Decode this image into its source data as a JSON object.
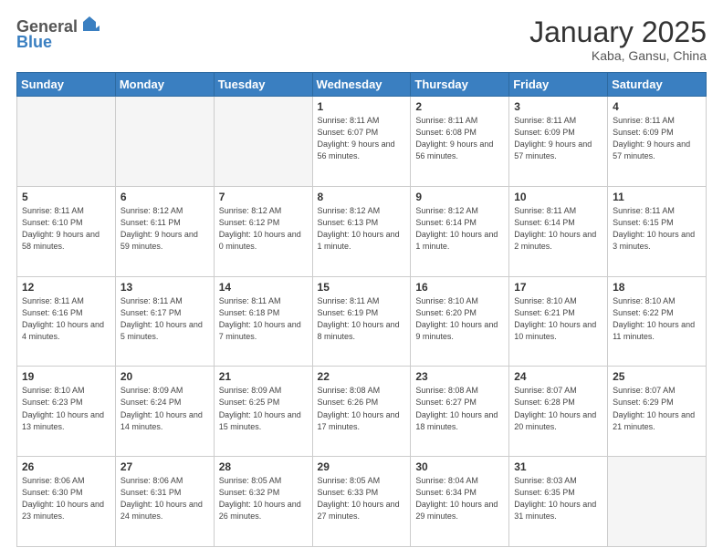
{
  "header": {
    "logo_general": "General",
    "logo_blue": "Blue",
    "month_title": "January 2025",
    "location": "Kaba, Gansu, China"
  },
  "days_of_week": [
    "Sunday",
    "Monday",
    "Tuesday",
    "Wednesday",
    "Thursday",
    "Friday",
    "Saturday"
  ],
  "weeks": [
    [
      {
        "day": "",
        "info": ""
      },
      {
        "day": "",
        "info": ""
      },
      {
        "day": "",
        "info": ""
      },
      {
        "day": "1",
        "info": "Sunrise: 8:11 AM\nSunset: 6:07 PM\nDaylight: 9 hours and 56 minutes."
      },
      {
        "day": "2",
        "info": "Sunrise: 8:11 AM\nSunset: 6:08 PM\nDaylight: 9 hours and 56 minutes."
      },
      {
        "day": "3",
        "info": "Sunrise: 8:11 AM\nSunset: 6:09 PM\nDaylight: 9 hours and 57 minutes."
      },
      {
        "day": "4",
        "info": "Sunrise: 8:11 AM\nSunset: 6:09 PM\nDaylight: 9 hours and 57 minutes."
      }
    ],
    [
      {
        "day": "5",
        "info": "Sunrise: 8:11 AM\nSunset: 6:10 PM\nDaylight: 9 hours and 58 minutes."
      },
      {
        "day": "6",
        "info": "Sunrise: 8:12 AM\nSunset: 6:11 PM\nDaylight: 9 hours and 59 minutes."
      },
      {
        "day": "7",
        "info": "Sunrise: 8:12 AM\nSunset: 6:12 PM\nDaylight: 10 hours and 0 minutes."
      },
      {
        "day": "8",
        "info": "Sunrise: 8:12 AM\nSunset: 6:13 PM\nDaylight: 10 hours and 1 minute."
      },
      {
        "day": "9",
        "info": "Sunrise: 8:12 AM\nSunset: 6:14 PM\nDaylight: 10 hours and 1 minute."
      },
      {
        "day": "10",
        "info": "Sunrise: 8:11 AM\nSunset: 6:14 PM\nDaylight: 10 hours and 2 minutes."
      },
      {
        "day": "11",
        "info": "Sunrise: 8:11 AM\nSunset: 6:15 PM\nDaylight: 10 hours and 3 minutes."
      }
    ],
    [
      {
        "day": "12",
        "info": "Sunrise: 8:11 AM\nSunset: 6:16 PM\nDaylight: 10 hours and 4 minutes."
      },
      {
        "day": "13",
        "info": "Sunrise: 8:11 AM\nSunset: 6:17 PM\nDaylight: 10 hours and 5 minutes."
      },
      {
        "day": "14",
        "info": "Sunrise: 8:11 AM\nSunset: 6:18 PM\nDaylight: 10 hours and 7 minutes."
      },
      {
        "day": "15",
        "info": "Sunrise: 8:11 AM\nSunset: 6:19 PM\nDaylight: 10 hours and 8 minutes."
      },
      {
        "day": "16",
        "info": "Sunrise: 8:10 AM\nSunset: 6:20 PM\nDaylight: 10 hours and 9 minutes."
      },
      {
        "day": "17",
        "info": "Sunrise: 8:10 AM\nSunset: 6:21 PM\nDaylight: 10 hours and 10 minutes."
      },
      {
        "day": "18",
        "info": "Sunrise: 8:10 AM\nSunset: 6:22 PM\nDaylight: 10 hours and 11 minutes."
      }
    ],
    [
      {
        "day": "19",
        "info": "Sunrise: 8:10 AM\nSunset: 6:23 PM\nDaylight: 10 hours and 13 minutes."
      },
      {
        "day": "20",
        "info": "Sunrise: 8:09 AM\nSunset: 6:24 PM\nDaylight: 10 hours and 14 minutes."
      },
      {
        "day": "21",
        "info": "Sunrise: 8:09 AM\nSunset: 6:25 PM\nDaylight: 10 hours and 15 minutes."
      },
      {
        "day": "22",
        "info": "Sunrise: 8:08 AM\nSunset: 6:26 PM\nDaylight: 10 hours and 17 minutes."
      },
      {
        "day": "23",
        "info": "Sunrise: 8:08 AM\nSunset: 6:27 PM\nDaylight: 10 hours and 18 minutes."
      },
      {
        "day": "24",
        "info": "Sunrise: 8:07 AM\nSunset: 6:28 PM\nDaylight: 10 hours and 20 minutes."
      },
      {
        "day": "25",
        "info": "Sunrise: 8:07 AM\nSunset: 6:29 PM\nDaylight: 10 hours and 21 minutes."
      }
    ],
    [
      {
        "day": "26",
        "info": "Sunrise: 8:06 AM\nSunset: 6:30 PM\nDaylight: 10 hours and 23 minutes."
      },
      {
        "day": "27",
        "info": "Sunrise: 8:06 AM\nSunset: 6:31 PM\nDaylight: 10 hours and 24 minutes."
      },
      {
        "day": "28",
        "info": "Sunrise: 8:05 AM\nSunset: 6:32 PM\nDaylight: 10 hours and 26 minutes."
      },
      {
        "day": "29",
        "info": "Sunrise: 8:05 AM\nSunset: 6:33 PM\nDaylight: 10 hours and 27 minutes."
      },
      {
        "day": "30",
        "info": "Sunrise: 8:04 AM\nSunset: 6:34 PM\nDaylight: 10 hours and 29 minutes."
      },
      {
        "day": "31",
        "info": "Sunrise: 8:03 AM\nSunset: 6:35 PM\nDaylight: 10 hours and 31 minutes."
      },
      {
        "day": "",
        "info": ""
      }
    ]
  ]
}
